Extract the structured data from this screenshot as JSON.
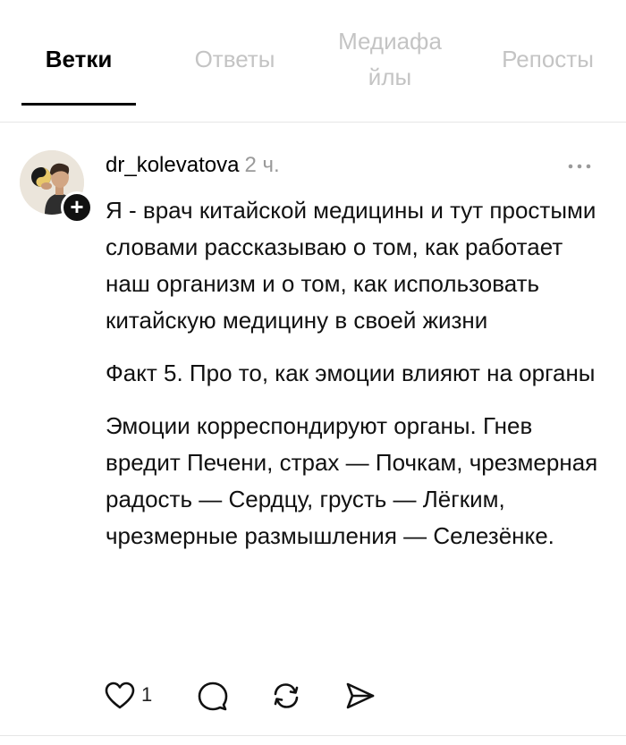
{
  "tabs": [
    {
      "label": "Ветки",
      "active": true
    },
    {
      "label": "Ответы",
      "active": false
    },
    {
      "label": "Медиафа йлы",
      "active": false
    },
    {
      "label": "Репосты",
      "active": false
    }
  ],
  "post": {
    "username": "dr_kolevatova",
    "timestamp": "2 ч.",
    "paragraphs": [
      "Я - врач китайской медицины и тут простыми словами рассказываю о том, как работает наш организм и о том, как использовать китайскую медицину в своей жизни",
      "Факт 5.  Про то, как эмоции влияют на органы",
      "Эмоции корреспондируют органы. Гнев вредит Печени, страх — Почкам, чрезмерная радость — Сердцу, грусть — Лёгким, чрезмерные размышления — Селезёнке."
    ],
    "like_count": "1",
    "icons": {
      "more": "more-horizontal-icon",
      "like": "heart-icon",
      "reply": "comment-icon",
      "repost": "repost-icon",
      "share": "send-icon",
      "follow": "plus-icon"
    }
  },
  "colors": {
    "accent": "#000000",
    "inactive_tab": "#c4c4c4",
    "timestamp": "#9a9a9a",
    "divider": "#e6e6e6"
  }
}
